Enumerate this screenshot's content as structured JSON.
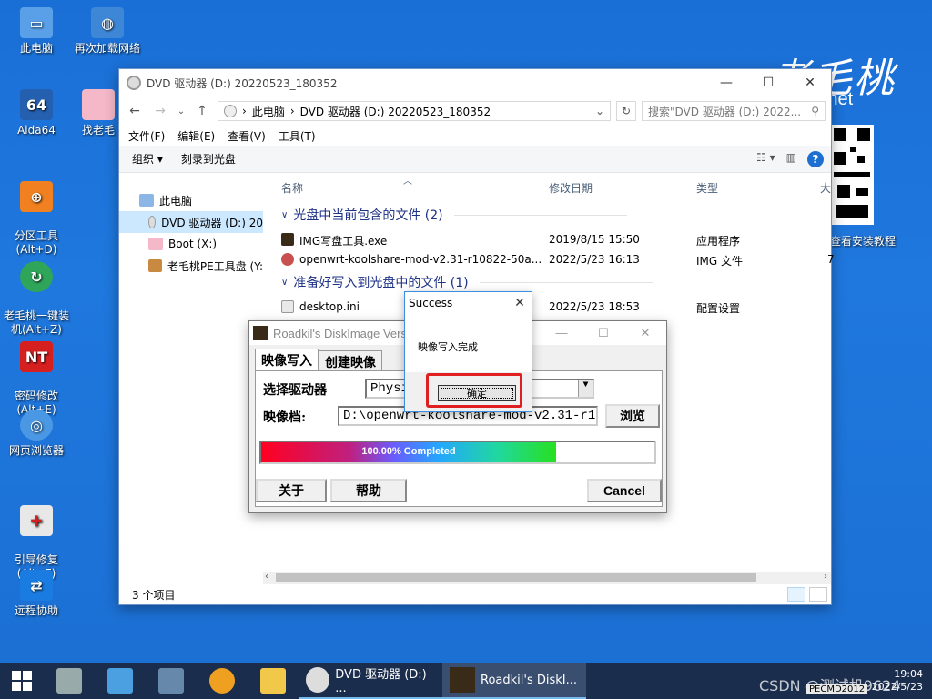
{
  "desktop": {
    "icons": [
      {
        "label": "此电脑"
      },
      {
        "label": "再次加载网络"
      },
      {
        "label": "Aida64"
      },
      {
        "label": "找老毛"
      },
      {
        "label": "分区工具\n(Alt+D)"
      },
      {
        "label": "老毛桃一键装\n机(Alt+Z)"
      },
      {
        "label": "密码修改\n(Alt+E)"
      },
      {
        "label": "网页浏览器"
      },
      {
        "label": "引导修复\n(Alt+F)"
      },
      {
        "label": "远程协助"
      }
    ],
    "brand_logo": "老毛桃",
    "brand_domain": "tao.net",
    "qr_caption": "查看安装教程"
  },
  "explorer": {
    "title": "DVD 驱动器 (D:) 20220523_180352",
    "address": [
      "此电脑",
      "DVD 驱动器 (D:) 20220523_180352"
    ],
    "search_placeholder": "搜索\"DVD 驱动器 (D:) 2022...",
    "menu": [
      "文件(F)",
      "编辑(E)",
      "查看(V)",
      "工具(T)"
    ],
    "commands": {
      "organize": "组织 ▾",
      "burn": "刻录到光盘"
    },
    "nav": [
      {
        "label": "此电脑"
      },
      {
        "label": "DVD 驱动器 (D:) 20"
      },
      {
        "label": "Boot (X:)"
      },
      {
        "label": "老毛桃PE工具盘 (Y:"
      }
    ],
    "columns": {
      "name": "名称",
      "date": "修改日期",
      "type": "类型",
      "size": "大"
    },
    "groups": [
      {
        "title": "光盘中当前包含的文件 (2)",
        "files": [
          {
            "name": "IMG写盘工具.exe",
            "date": "2019/8/15 15:50",
            "type": "应用程序",
            "extra": ""
          },
          {
            "name": "openwrt-koolshare-mod-v2.31-r10822-50a...",
            "date": "2022/5/23 16:13",
            "type": "IMG 文件",
            "extra": "7"
          }
        ]
      },
      {
        "title": "准备好写入到光盘中的文件 (1)",
        "files": [
          {
            "name": "desktop.ini",
            "date": "2022/5/23 18:53",
            "type": "配置设置",
            "extra": ""
          }
        ]
      }
    ],
    "status": "3 个项目"
  },
  "diskimage": {
    "title": "Roadkil's DiskImage Vers",
    "tabs": [
      "映像写入",
      "创建映像"
    ],
    "drive_label": "选择驱动器",
    "drive_value": "Physic",
    "file_label": "映像档:",
    "file_value": "D:\\openwrt-koolshare-mod-v2.31-r10822-50a",
    "browse": "浏览",
    "progress_text": "100.00% Completed",
    "progress_fraction": 1.0,
    "about": "关于",
    "help": "帮助",
    "cancel": "Cancel"
  },
  "success_dialog": {
    "title": "Success",
    "message": "映像写入完成",
    "ok": "确定"
  },
  "taskbar": {
    "tasks": [
      {
        "label": "DVD 驱动器 (D:) ..."
      },
      {
        "label": "Roadkil's DiskI..."
      }
    ],
    "time": "19:04",
    "date": "2022/5/23",
    "watermark": "CSDN @测试机9624",
    "pe_info": "PECMD2012"
  }
}
